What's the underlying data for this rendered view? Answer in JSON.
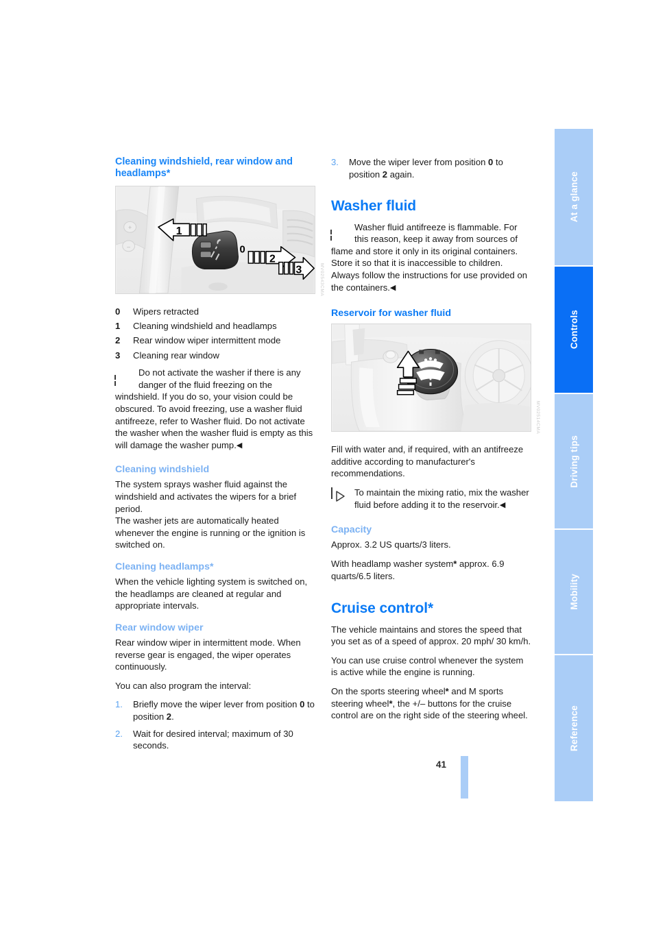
{
  "page": {
    "number": "41",
    "accent_primary": "#0a7af5",
    "accent_light": "#7cb2f3",
    "tab_inactive": "#aacdf7",
    "tab_active": "#0a6ff5"
  },
  "tabs": [
    {
      "label": "At a glance",
      "active": false
    },
    {
      "label": "Controls",
      "active": true
    },
    {
      "label": "Driving tips",
      "active": false
    },
    {
      "label": "Mobility",
      "active": false
    },
    {
      "label": "Reference",
      "active": false
    }
  ],
  "left_column": {
    "heading": "Cleaning windshield, rear window and headlamps*",
    "figure": {
      "name": "wiper-lever-illustration",
      "code": "MV02543CMA",
      "callouts": [
        "1",
        "0",
        "2",
        "3"
      ],
      "description": "Steering column wiper lever with arrows showing positions 1, 0, 2 and 3"
    },
    "legend": [
      {
        "num": "0",
        "text": "Wipers retracted"
      },
      {
        "num": "1",
        "text": "Cleaning windshield and headlamps"
      },
      {
        "num": "2",
        "text": "Rear window wiper intermittent mode"
      },
      {
        "num": "3",
        "text": "Cleaning rear window"
      }
    ],
    "warning": "Do not activate the washer if there is any danger of the fluid freezing on the windshield. If you do so, your vision could be obscured. To avoid freezing, use a washer fluid antifreeze, refer to Washer fluid. Do not activate the washer when the washer fluid is empty as this will damage the washer pump.",
    "cleaning_windshield": {
      "heading": "Cleaning windshield",
      "paragraph1": "The system sprays washer fluid against the windshield and activates the wipers for a brief period.",
      "paragraph2": "The washer jets are automatically heated whenever the engine is running or the ignition is switched on."
    },
    "cleaning_headlamps": {
      "heading": "Cleaning headlamps*",
      "paragraph1": "When the vehicle lighting system is switched on, the headlamps are cleaned at regular and appropriate intervals."
    },
    "rear_window_wiper": {
      "heading": "Rear window wiper",
      "paragraph1": "Rear window wiper in intermittent mode. When reverse gear is engaged, the wiper operates continuously.",
      "paragraph2": "You can also program the interval:",
      "steps": [
        {
          "num": "1.",
          "pre": "Briefly move the wiper lever from position ",
          "bold1": "0",
          "mid": " to position ",
          "bold2": "2",
          "post": "."
        },
        {
          "num": "2.",
          "pre": "Wait for desired interval; maximum of 30 seconds.",
          "bold1": "",
          "mid": "",
          "bold2": "",
          "post": ""
        }
      ]
    }
  },
  "right_column": {
    "continued_step": {
      "num": "3.",
      "pre": "Move the wiper lever from position ",
      "bold1": "0",
      "mid": " to position ",
      "bold2": "2",
      "post": " again."
    },
    "washer_fluid": {
      "heading": "Washer fluid",
      "warning": "Washer fluid antifreeze is flammable. For this reason, keep it away from sources of flame and store it only in its original containers. Store it so that it is inaccessible to children. Always follow the instructions for use provided on the containers.",
      "reservoir": {
        "heading": "Reservoir for washer fluid",
        "figure": {
          "name": "washer-fluid-reservoir-illustration",
          "code": "MV02514CMA",
          "description": "Engine bay washer fluid reservoir cap with wiper symbol and upward arrow"
        },
        "paragraph1": "Fill with water and, if required, with an antifreeze additive according to manufacturer's recommendations.",
        "note": "To maintain the mixing ratio, mix the washer fluid before adding it to the reservoir."
      },
      "capacity": {
        "heading": "Capacity",
        "paragraph1": "Approx. 3.2 US quarts/3 liters.",
        "paragraph2_pre": "With headlamp washer system",
        "paragraph2_star": "*",
        "paragraph2_post": " approx. 6.9 quarts/6.5 liters."
      }
    },
    "cruise_control": {
      "heading": "Cruise control*",
      "paragraph1": "The vehicle maintains and stores the speed that you set as of a speed of approx. 20 mph/ 30 km/h.",
      "paragraph2": "You can use cruise control whenever the system is active while the engine is running.",
      "paragraph3_pre": "On the sports steering wheel",
      "paragraph3_mid": " and M sports steering wheel",
      "paragraph3_post": ", the +/– buttons for the cruise control are on the right side of the steering wheel."
    }
  }
}
